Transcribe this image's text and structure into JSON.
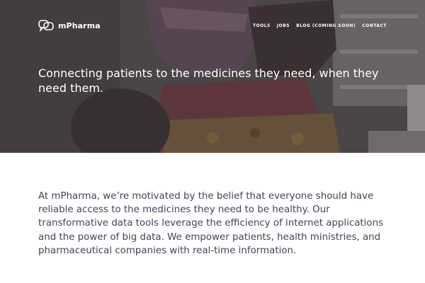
{
  "brand": {
    "name": "mPharma",
    "logo_icon": "speech-bubbles-logo-icon"
  },
  "nav": {
    "items": [
      {
        "label": "TOOLS"
      },
      {
        "label": "JOBS"
      },
      {
        "label": "BLOG (COMING SOON)"
      },
      {
        "label": "CONTACT"
      }
    ]
  },
  "hero": {
    "headline": "Connecting patients to the medicines they need, when they need them."
  },
  "intro": {
    "text": "At mPharma, we’re motivated by the belief that everyone should have reliable access to the medicines they need to be healthy. Our transformative data tools leverage the efficiency of internet applications and the power of big data. We empower patients, health ministries, and pharmaceutical companies with real-time information."
  },
  "colors": {
    "hero_overlay": "#37343a",
    "body_text": "#3f4656",
    "nav_text": "#ffffff"
  }
}
